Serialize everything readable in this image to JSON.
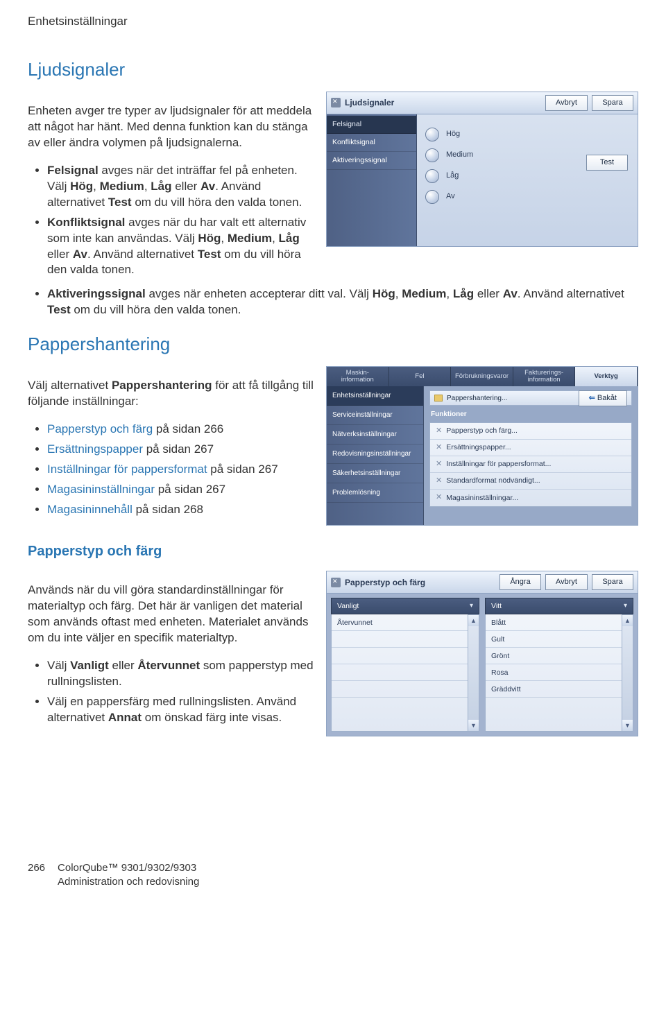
{
  "header": "Enhetsinställningar",
  "section1_title": "Ljudsignaler",
  "intro": "Enheten avger tre typer av ljudsignaler för att meddela att något har hänt. Med denna funktion kan du stänga av eller ändra volymen på ljudsignalerna.",
  "b1": {
    "a1": "Felsignal",
    "a2": " avges när det inträffar fel på enheten. Välj ",
    "a3": "Hög",
    "a4": "Medium",
    "a5": "Låg",
    "a6": " eller ",
    "a7": "Av",
    "a8": ". Använd alternativet ",
    "a9": "Test",
    "a10": " om du vill höra den valda tonen."
  },
  "b2": {
    "a1": "Konfliktsignal",
    "a2": " avges när du har valt ett alternativ som inte kan användas. Välj ",
    "a3": "Hög",
    "a4": "Medium",
    "a5": "Låg",
    "a6": " eller ",
    "a7": "Av",
    "a8": ". Använd alternativet ",
    "a9": "Test",
    "a10": " om du vill höra den valda tonen."
  },
  "b3": {
    "a1": "Aktiveringssignal",
    "a2": " avges när enheten accepterar ditt val. Välj ",
    "a3": "Hög",
    "a4": "Medium",
    "a5": "Låg",
    "a6": " eller ",
    "a7": "Av",
    "a8": ". Använd alternativet ",
    "a9": "Test",
    "a10": " om du vill höra den valda tonen."
  },
  "panel1": {
    "title": "Ljudsignaler",
    "btn_cancel": "Avbryt",
    "btn_save": "Spara",
    "side": [
      "Felsignal",
      "Konfliktsignal",
      "Aktiveringssignal"
    ],
    "radios": [
      "Hög",
      "Medium",
      "Låg",
      "Av"
    ],
    "test": "Test"
  },
  "section2_title": "Pappershantering",
  "section2_intro_a": "Välj alternativet ",
  "section2_intro_b": "Pappershantering",
  "section2_intro_c": " för att få tillgång till följande inställningar:",
  "links": {
    "l1a": "Papperstyp och färg",
    "l1b": " på sidan 266",
    "l2a": "Ersättningspapper",
    "l2b": " på sidan 267",
    "l3a": "Inställningar för pappersformat",
    "l3b": " på sidan 267",
    "l4a": "Magasininställningar",
    "l4b": " på sidan 267",
    "l5a": "Magasininnehåll",
    "l5b": " på sidan 268"
  },
  "panel2": {
    "tabs": [
      "Maskin-\ninformation",
      "Fel",
      "Förbrukningsvaror",
      "Fakturerings-\ninformation",
      "Verktyg"
    ],
    "side": [
      "Enhetsinställningar",
      "Serviceinställningar",
      "Nätverksinställningar",
      "Redovisningsinställningar",
      "Säkerhetsinställningar",
      "Problemlösning"
    ],
    "breadcrumb": "Pappershantering...",
    "back": "Bakåt",
    "group": "Funktioner",
    "items": [
      "Papperstyp och färg...",
      "Ersättningspapper...",
      "Inställningar för pappersformat...",
      "Standardformat nödvändigt...",
      "Magasininställningar..."
    ]
  },
  "subsection_title": "Papperstyp och färg",
  "para3": "Används när du vill göra standardinställningar för materialtyp och färg. Det här är vanligen det material som används oftast med enheten. Materialet används om du inte väljer en specifik materialtyp.",
  "b4": {
    "a1": "Välj ",
    "a2": "Vanligt",
    "a3": " eller ",
    "a4": "Återvunnet",
    "a5": " som papperstyp med rullningslisten."
  },
  "b5": {
    "a1": "Välj en pappersfärg med rullningslisten. Använd alternativet ",
    "a2": "Annat",
    "a3": " om önskad färg inte visas."
  },
  "panel3": {
    "title": "Papperstyp och färg",
    "btn_undo": "Ångra",
    "btn_cancel": "Avbryt",
    "btn_save": "Spara",
    "left_head": "Vanligt",
    "left_rows": [
      "Återvunnet",
      "",
      "",
      "",
      ""
    ],
    "right_head": "Vitt",
    "right_rows": [
      "Blått",
      "Gult",
      "Grönt",
      "Rosa",
      "Gräddvitt"
    ]
  },
  "footer": {
    "page": "266",
    "line1": "ColorQube™ 9301/9302/9303",
    "line2": "Administration och redovisning"
  }
}
